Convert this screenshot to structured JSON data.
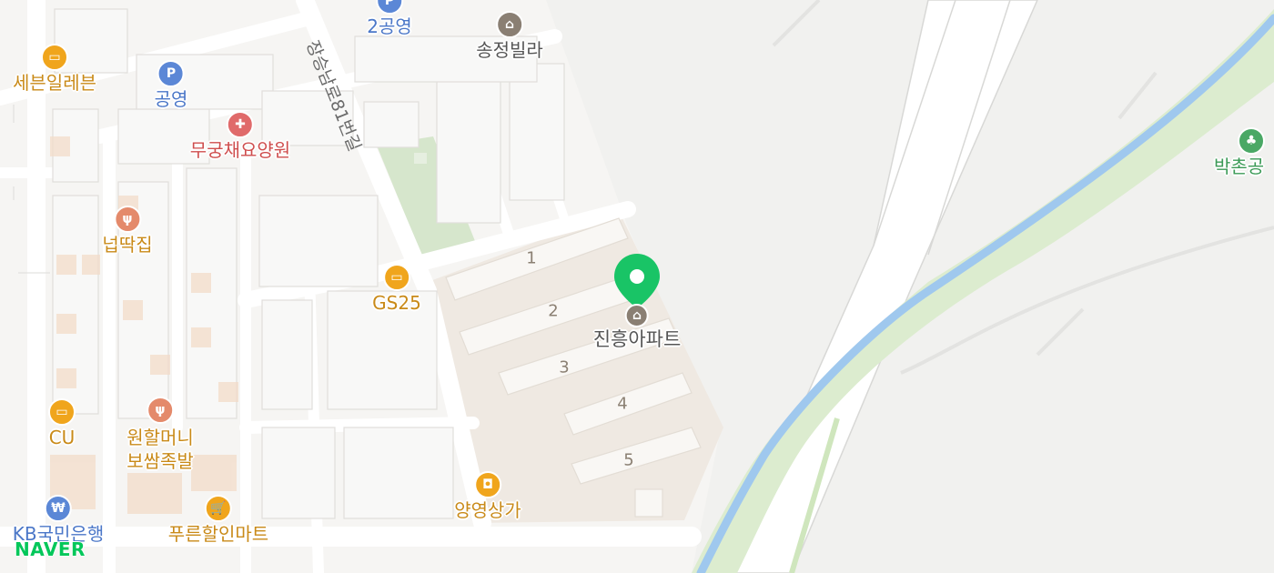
{
  "map": {
    "selected_place": {
      "name": "진흥아파트"
    },
    "pois": [
      {
        "id": "poi-2gongyoung",
        "label": "2공영",
        "type": "parking",
        "color": "#4b77c8"
      },
      {
        "id": "poi-songjeong-villa",
        "label": "송정빌라",
        "type": "building",
        "color": "#8a7f73"
      },
      {
        "id": "poi-seven-eleven",
        "label": "세븐일레븐",
        "type": "convenience-store",
        "color": "#f0a51c"
      },
      {
        "id": "poi-gongyoung",
        "label": "공영",
        "type": "parking",
        "color": "#4b77c8"
      },
      {
        "id": "poi-mugungchae",
        "label": "무궁채요양원",
        "type": "hospital",
        "color": "#e06a6a"
      },
      {
        "id": "poi-neoptteok",
        "label": "넙딱집",
        "type": "restaurant",
        "color": "#e48a6b"
      },
      {
        "id": "poi-gs25",
        "label": "GS25",
        "type": "convenience-store",
        "color": "#f0a51c"
      },
      {
        "id": "poi-cu",
        "label": "CU",
        "type": "convenience-store",
        "color": "#f0a51c"
      },
      {
        "id": "poi-wonhalmeoni",
        "label": "원할머니\n보쌈족발",
        "type": "restaurant",
        "color": "#e48a6b"
      },
      {
        "id": "poi-kb-bank",
        "label": "KB국민은행",
        "type": "bank",
        "color": "#4b77c8"
      },
      {
        "id": "poi-pureun-mart",
        "label": "푸른할인마트",
        "type": "mart",
        "color": "#f0a51c"
      },
      {
        "id": "poi-yangyoung",
        "label": "양영상가",
        "type": "shopping",
        "color": "#f0a51c"
      },
      {
        "id": "poi-bakchon-park",
        "label": "박촌공",
        "type": "park",
        "color": "#3b9a56"
      }
    ],
    "road_labels": [
      {
        "id": "road-1",
        "label": "장승남로81번길"
      }
    ],
    "building_numbers": [
      "1",
      "2",
      "3",
      "4",
      "5"
    ],
    "branding": {
      "logo": "NAVER"
    }
  }
}
